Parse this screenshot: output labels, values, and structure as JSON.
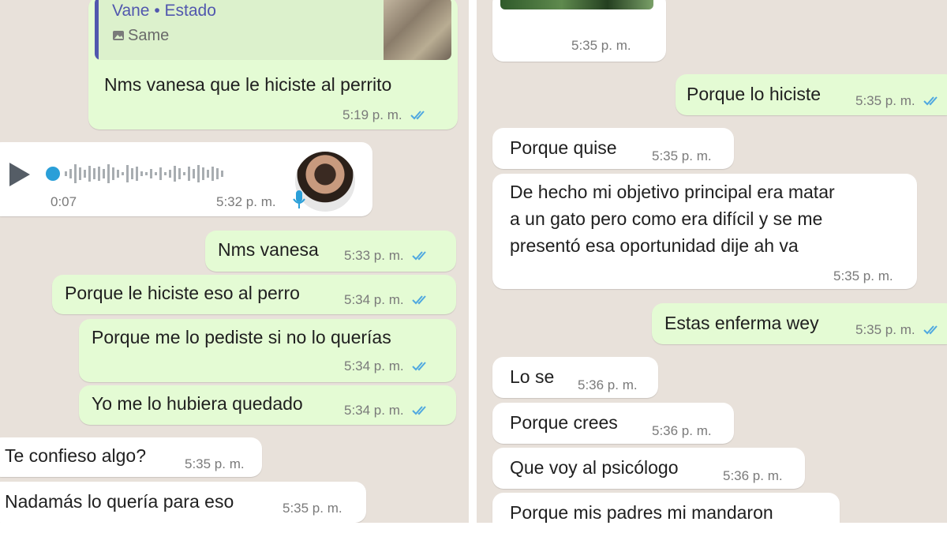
{
  "colors": {
    "chat_background": "#e8e1da",
    "outgoing_bubble": "#e4fbd4",
    "incoming_bubble": "#ffffff",
    "read_ticks": "#4fa8e0",
    "quote_accent": "#5157ae"
  },
  "left_chat": {
    "reply": {
      "quote_author": "Vane • Estado",
      "quote_subtitle": "Same",
      "text": "Nms vanesa que le hiciste al perrito",
      "time": "5:19 p. m."
    },
    "voice_note": {
      "duration": "0:07",
      "time": "5:32 p. m."
    },
    "messages": [
      {
        "text": "Nms vanesa",
        "time": "5:33 p. m."
      },
      {
        "text": "Porque le hiciste eso al perro",
        "time": "5:34 p. m."
      },
      {
        "text": "Porque me lo pediste si no lo querías",
        "time": "5:34 p. m."
      },
      {
        "text": "Yo me lo hubiera quedado",
        "time": "5:34 p. m."
      },
      {
        "text": "Te confieso algo?",
        "time": "5:35 p. m."
      },
      {
        "text": "Nadamás lo quería para eso",
        "time": "5:35 p. m."
      }
    ]
  },
  "right_chat": {
    "photo_time": "5:35 p. m.",
    "messages": [
      {
        "text": "Porque lo hiciste",
        "time": "5:35 p. m."
      },
      {
        "text": "Porque quise",
        "time": "5:35 p. m."
      },
      {
        "lines": [
          "De hecho mi objetivo principal era matar",
          "a un gato pero como era difícil y se me",
          "presentó esa oportunidad dije ah va"
        ],
        "time": "5:35 p. m."
      },
      {
        "text": "Estas enferma wey",
        "time": "5:35 p. m."
      },
      {
        "text": "Lo se",
        "time": "5:36 p. m."
      },
      {
        "text": "Porque crees",
        "time": "5:36 p. m."
      },
      {
        "text": "Que voy al psicólogo",
        "time": "5:36 p. m."
      },
      {
        "text": "Porque mis padres mi mandaron"
      }
    ]
  }
}
